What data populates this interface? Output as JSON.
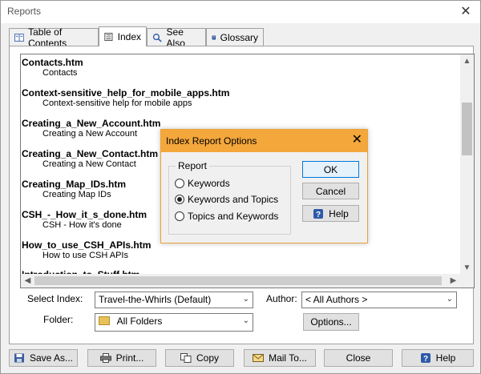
{
  "window": {
    "title": "Reports",
    "close_glyph": "✕"
  },
  "tabs": [
    {
      "label": "Table of Contents",
      "icon": "book-icon"
    },
    {
      "label": "Index",
      "icon": "index-icon",
      "active": true
    },
    {
      "label": "See Also",
      "icon": "search-icon"
    },
    {
      "label": "Glossary",
      "icon": "glossary-icon"
    }
  ],
  "entries": [
    {
      "file": "Contacts.htm",
      "sub": "Contacts"
    },
    {
      "file": "Context-sensitive_help_for_mobile_apps.htm",
      "sub": "Context-sensitive help for mobile apps"
    },
    {
      "file": "Creating_a_New_Account.htm",
      "sub": "Creating a New Account"
    },
    {
      "file": "Creating_a_New_Contact.htm",
      "sub": "Creating a New Contact"
    },
    {
      "file": "Creating_Map_IDs.htm",
      "sub": "Creating Map IDs"
    },
    {
      "file": "CSH_-_How_it_s_done.htm",
      "sub": "CSH - How it's done"
    },
    {
      "file": "How_to_use_CSH_APIs.htm",
      "sub": "How to use CSH APIs"
    },
    {
      "file": "Introduction_to_Stuff.htm",
      "sub": ""
    }
  ],
  "form": {
    "select_index_label": "Select Index:",
    "select_index_value": "Travel-the-Whirls (Default)",
    "author_label": "Author:",
    "author_value": "< All Authors >",
    "folder_label": "Folder:",
    "folder_value": "All Folders",
    "options_label": "Options..."
  },
  "buttons": {
    "save_as": "Save As...",
    "print": "Print...",
    "copy": "Copy",
    "mail_to": "Mail To...",
    "close": "Close",
    "help": "Help"
  },
  "dialog": {
    "title": "Index Report Options",
    "close_glyph": "✕",
    "group_label": "Report",
    "options": [
      {
        "label": "Keywords",
        "selected": false
      },
      {
        "label": "Keywords and Topics",
        "selected": true
      },
      {
        "label": "Topics and Keywords",
        "selected": false
      }
    ],
    "ok": "OK",
    "cancel": "Cancel",
    "help": "Help"
  },
  "colors": {
    "dialog_title": "#f4a73b",
    "focus_border": "#0078d7"
  }
}
